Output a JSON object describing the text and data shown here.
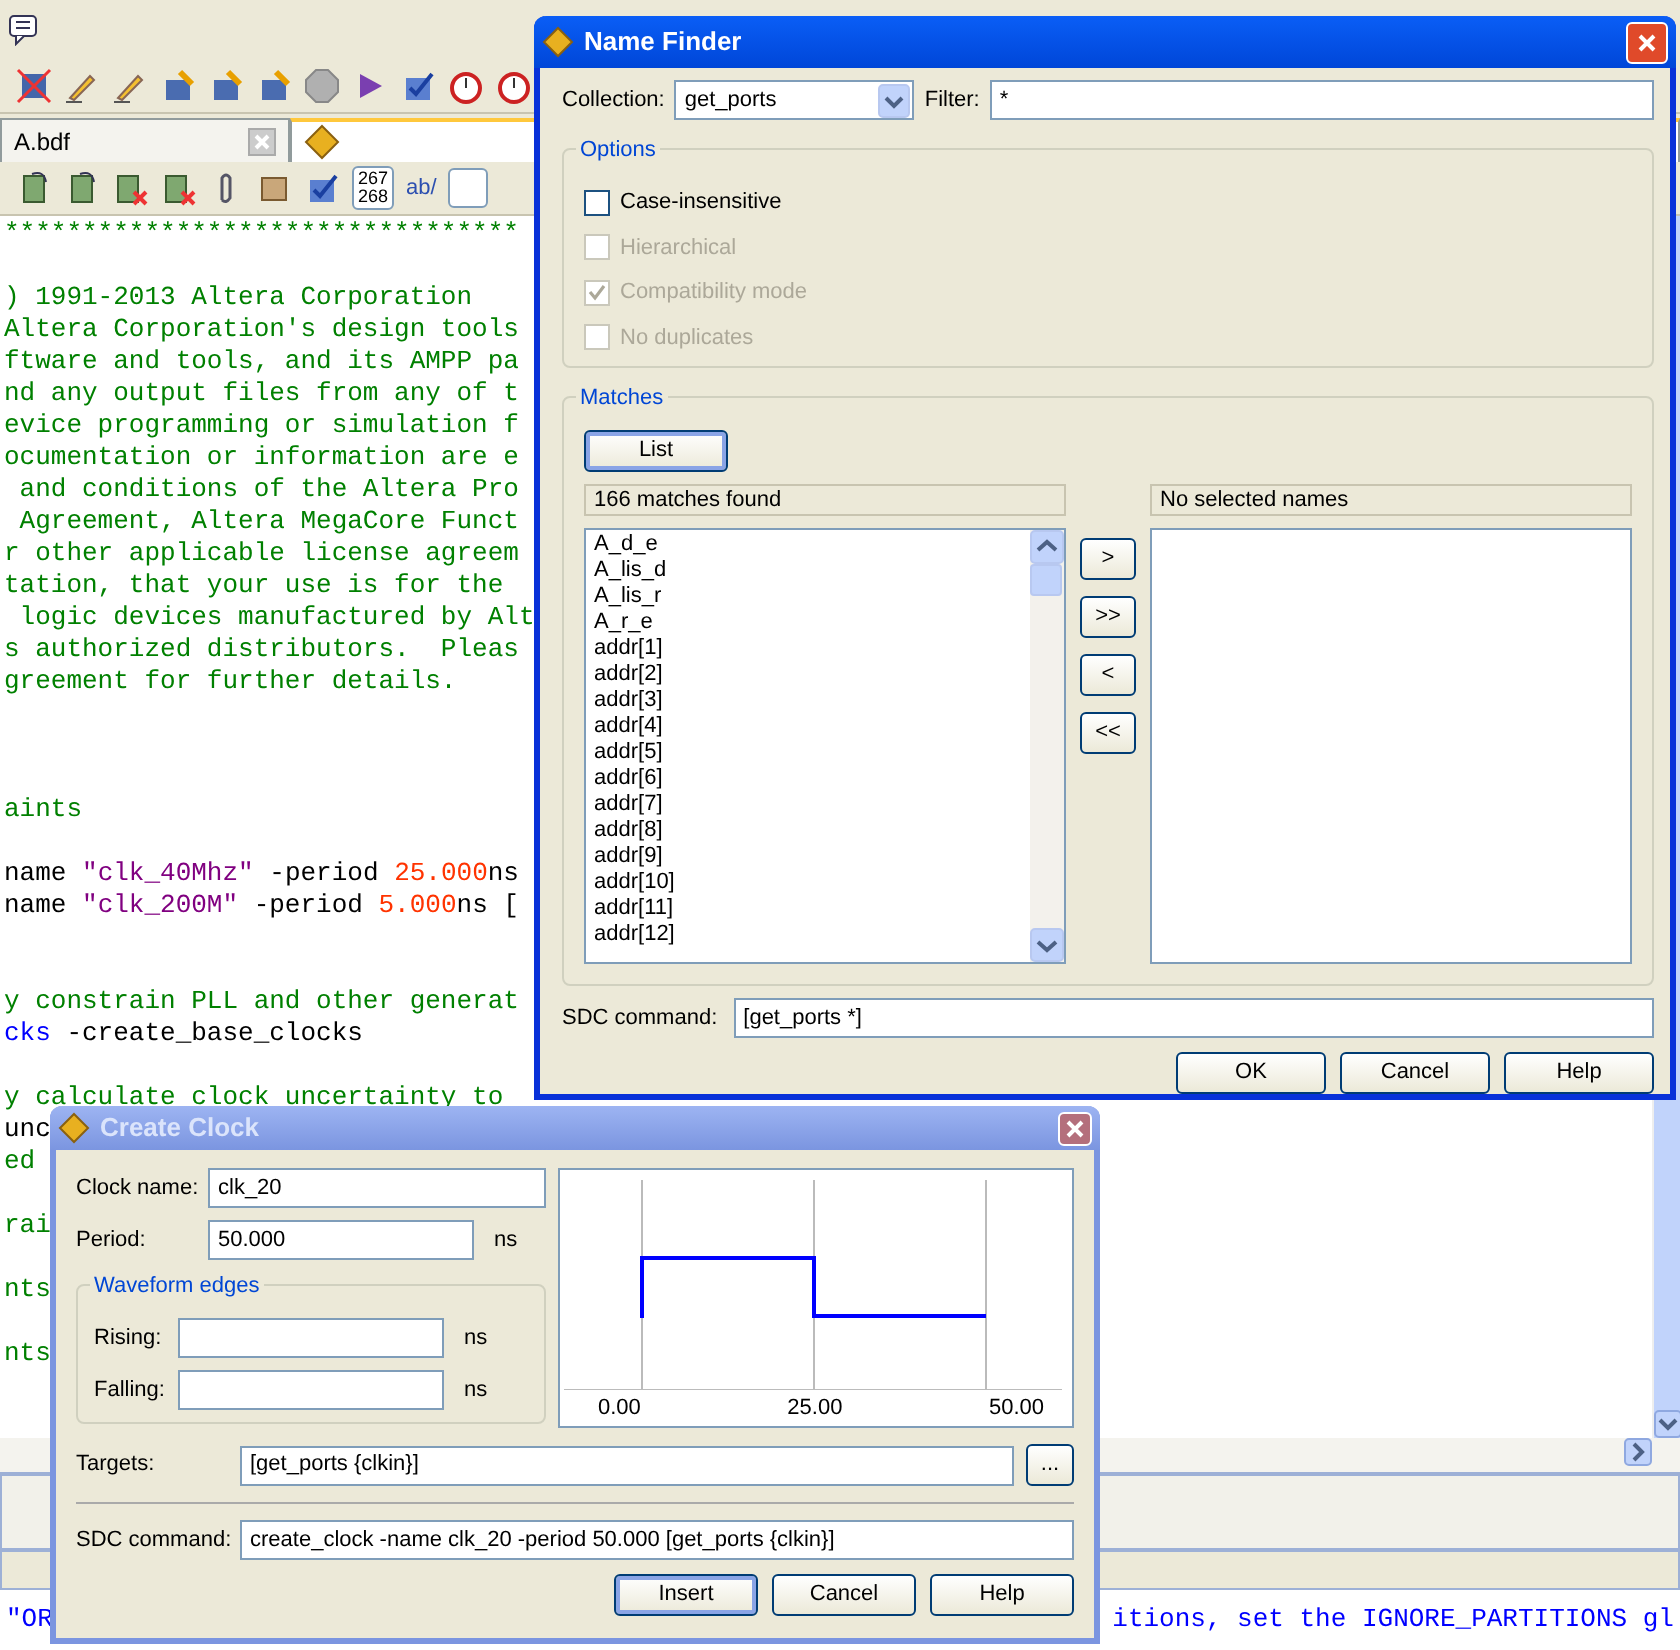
{
  "editor": {
    "tabs": [
      {
        "label": "A.bdf",
        "selected": false,
        "closable": true
      },
      {
        "selected": true,
        "closable": false
      }
    ],
    "line_counter": [
      "267",
      "268"
    ],
    "find_label": "ab/",
    "code_lines": [
      {
        "kind": "code",
        "segments": [
          {
            "kind": "comment",
            "text": "*********************************"
          }
        ]
      },
      {
        "kind": "blank"
      },
      {
        "kind": "code",
        "segments": [
          {
            "kind": "comment",
            "text": ") 1991-2013 Altera Corporation"
          }
        ]
      },
      {
        "kind": "code",
        "segments": [
          {
            "kind": "comment",
            "text": "Altera Corporation's design tools"
          }
        ]
      },
      {
        "kind": "code",
        "segments": [
          {
            "kind": "comment",
            "text": "ftware and tools, and its AMPP pa"
          }
        ]
      },
      {
        "kind": "code",
        "segments": [
          {
            "kind": "comment",
            "text": "nd any output files from any of t"
          }
        ]
      },
      {
        "kind": "code",
        "segments": [
          {
            "kind": "comment",
            "text": "evice programming or simulation f"
          }
        ]
      },
      {
        "kind": "code",
        "segments": [
          {
            "kind": "comment",
            "text": "ocumentation or information are e"
          }
        ]
      },
      {
        "kind": "code",
        "segments": [
          {
            "kind": "comment",
            "text": " and conditions of the Altera Pro"
          }
        ]
      },
      {
        "kind": "code",
        "segments": [
          {
            "kind": "comment",
            "text": " Agreement, Altera MegaCore Funct"
          }
        ]
      },
      {
        "kind": "code",
        "segments": [
          {
            "kind": "comment",
            "text": "r other applicable license agreem"
          }
        ]
      },
      {
        "kind": "code",
        "segments": [
          {
            "kind": "comment",
            "text": "tation, that your use is for the"
          }
        ]
      },
      {
        "kind": "code",
        "segments": [
          {
            "kind": "comment",
            "text": " logic devices manufactured by Alt"
          }
        ]
      },
      {
        "kind": "code",
        "segments": [
          {
            "kind": "comment",
            "text": "s authorized distributors.  Pleas"
          }
        ]
      },
      {
        "kind": "code",
        "segments": [
          {
            "kind": "comment",
            "text": "greement for further details."
          }
        ]
      },
      {
        "kind": "blank"
      },
      {
        "kind": "blank"
      },
      {
        "kind": "blank"
      },
      {
        "kind": "code",
        "segments": [
          {
            "kind": "comment",
            "text": "aints"
          }
        ]
      },
      {
        "kind": "blank"
      },
      {
        "kind": "code",
        "segments": [
          {
            "kind": "plain",
            "text": "name "
          },
          {
            "kind": "string",
            "text": "\"clk_40Mhz\""
          },
          {
            "kind": "plain",
            "text": " -period "
          },
          {
            "kind": "number",
            "text": "25.000"
          },
          {
            "kind": "plain",
            "text": "ns"
          }
        ]
      },
      {
        "kind": "code",
        "segments": [
          {
            "kind": "plain",
            "text": "name "
          },
          {
            "kind": "string",
            "text": "\"clk_200M\""
          },
          {
            "kind": "plain",
            "text": " -period "
          },
          {
            "kind": "number",
            "text": "5.000"
          },
          {
            "kind": "plain",
            "text": "ns ["
          }
        ]
      },
      {
        "kind": "blank"
      },
      {
        "kind": "blank"
      },
      {
        "kind": "code",
        "segments": [
          {
            "kind": "comment",
            "text": "y constrain PLL and other generat"
          }
        ]
      },
      {
        "kind": "code",
        "segments": [
          {
            "kind": "keyword",
            "text": "cks"
          },
          {
            "kind": "plain",
            "text": " -create_base_clocks"
          }
        ]
      },
      {
        "kind": "blank"
      },
      {
        "kind": "code",
        "segments": [
          {
            "kind": "comment",
            "text": "y calculate clock uncertainty to"
          }
        ]
      },
      {
        "kind": "code",
        "segments": [
          {
            "kind": "plain",
            "text": "unc"
          }
        ]
      },
      {
        "kind": "code",
        "segments": [
          {
            "kind": "comment",
            "text": "ed"
          }
        ]
      },
      {
        "kind": "blank"
      },
      {
        "kind": "code",
        "segments": [
          {
            "kind": "comment",
            "text": "rai"
          }
        ]
      },
      {
        "kind": "blank"
      },
      {
        "kind": "code",
        "segments": [
          {
            "kind": "comment",
            "text": "nts"
          }
        ]
      },
      {
        "kind": "blank"
      },
      {
        "kind": "code",
        "segments": [
          {
            "kind": "comment",
            "text": "nts"
          }
        ]
      }
    ],
    "message_fragments": [
      "\"OR",
      "itions, set the IGNORE_PARTITIONS gl"
    ]
  },
  "name_finder": {
    "title": "Name Finder",
    "active": true,
    "collection_label": "Collection:",
    "collection": "get_ports",
    "filter_label": "Filter:",
    "filter": "*",
    "options_title": "Options",
    "options": [
      {
        "label": "Case-insensitive",
        "checked": false,
        "disabled": false
      },
      {
        "label": "Hierarchical",
        "checked": false,
        "disabled": true
      },
      {
        "label": "Compatibility mode",
        "checked": true,
        "disabled": true
      },
      {
        "label": "No duplicates",
        "checked": false,
        "disabled": true
      }
    ],
    "matches_title": "Matches",
    "list_button": "List",
    "matches_header": "166 matches found",
    "selected_header": "No selected names",
    "matches": [
      "A_d_e",
      "A_lis_d",
      "A_lis_r",
      "A_r_e",
      "addr[1]",
      "addr[2]",
      "addr[3]",
      "addr[4]",
      "addr[5]",
      "addr[6]",
      "addr[7]",
      "addr[8]",
      "addr[9]",
      "addr[10]",
      "addr[11]",
      "addr[12]"
    ],
    "move_buttons": [
      ">",
      ">>",
      "<",
      "<<"
    ],
    "sdc_label": "SDC command:",
    "sdc": "[get_ports *]",
    "buttons": [
      {
        "label": "OK",
        "default": false
      },
      {
        "label": "Cancel",
        "default": false
      },
      {
        "label": "Help",
        "default": false
      }
    ]
  },
  "create_clock": {
    "title": "Create Clock",
    "active": false,
    "clock_name_label": "Clock name:",
    "clock_name": "clk_20",
    "period_label": "Period:",
    "period": "50.000",
    "period_unit": "ns",
    "waveform_title": "Waveform edges",
    "edges": [
      {
        "label": "Rising:",
        "unit": "ns"
      },
      {
        "label": "Falling:",
        "unit": "ns"
      }
    ],
    "axis_labels": [
      "0.00",
      "25.00",
      "50.00"
    ],
    "targets_label": "Targets:",
    "targets": "[get_ports {clkin}]",
    "browse_button": "...",
    "sdc_label": "SDC command:",
    "sdc": "create_clock -name clk_20 -period 50.000 [get_ports {clkin}]",
    "buttons": [
      {
        "label": "Insert",
        "default": true
      },
      {
        "label": "Cancel",
        "default": false
      },
      {
        "label": "Help",
        "default": false
      }
    ]
  }
}
